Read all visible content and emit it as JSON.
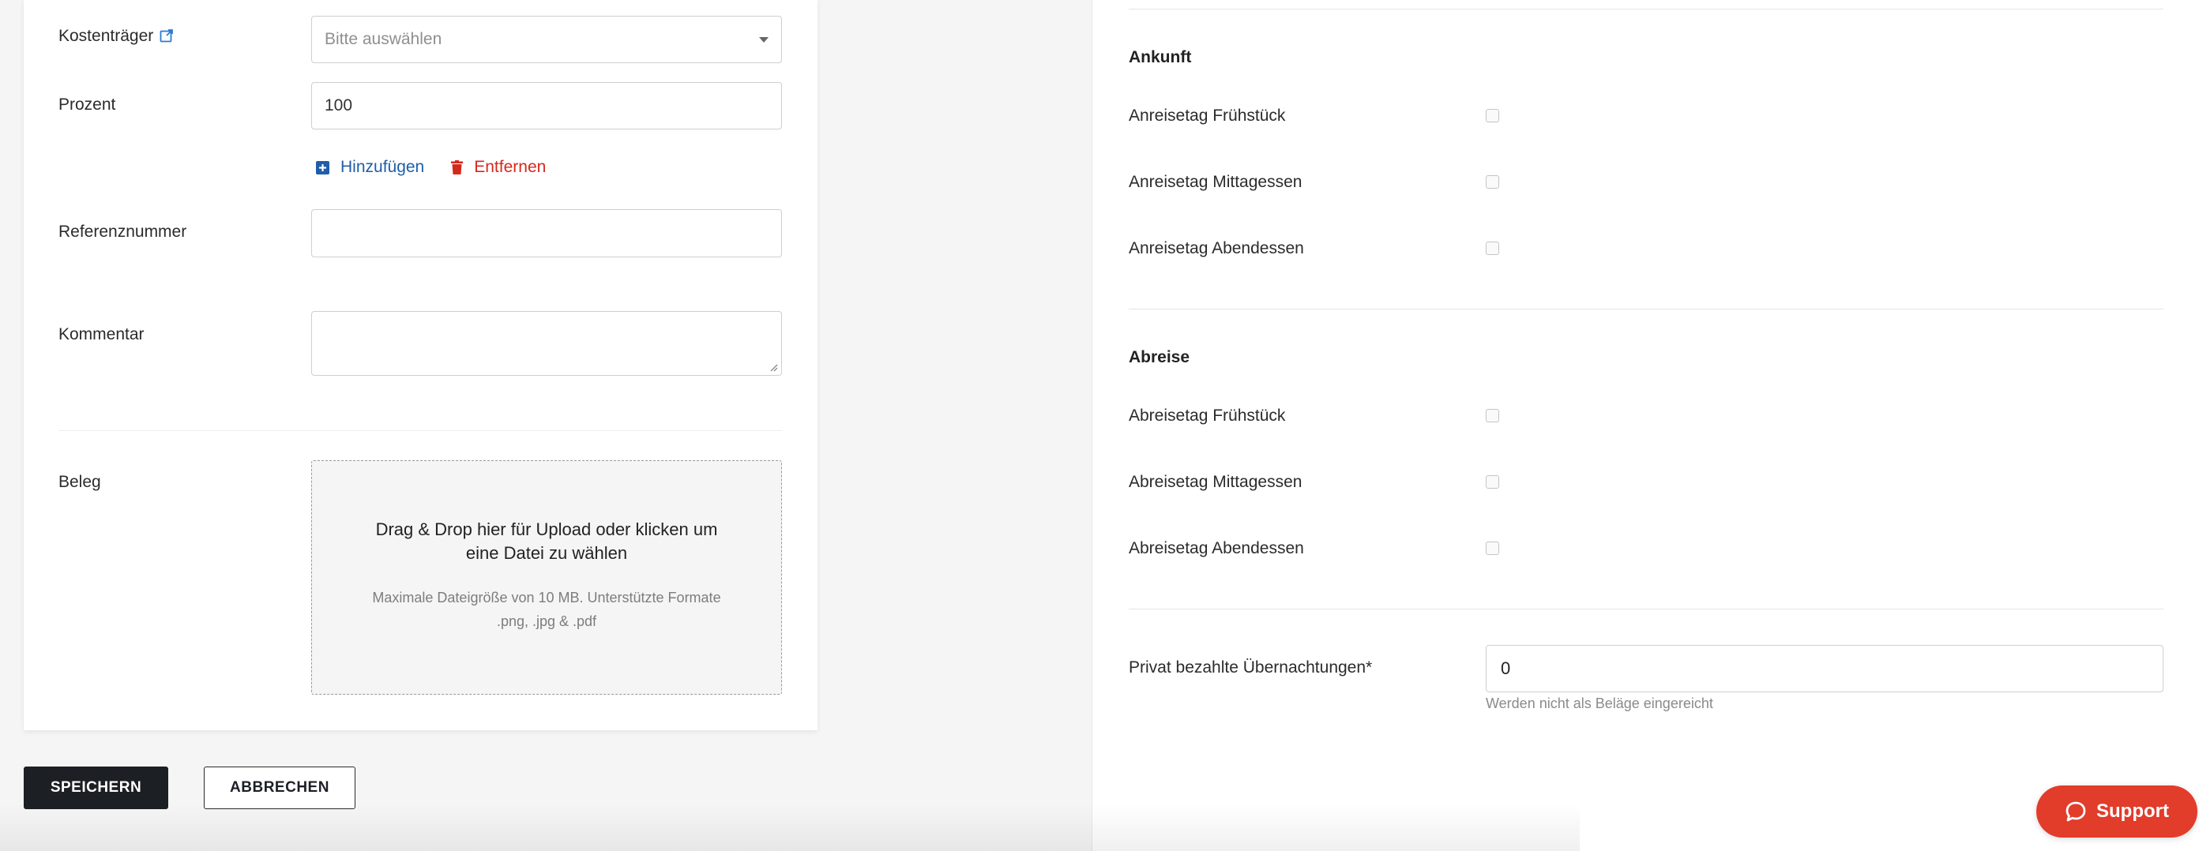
{
  "form": {
    "kostentraeger_label": "Kostenträger",
    "kostentraeger_placeholder": "Bitte auswählen",
    "prozent_label": "Prozent",
    "prozent_value": "100",
    "add_label": "Hinzufügen",
    "remove_label": "Entfernen",
    "referenz_label": "Referenznummer",
    "referenz_value": "",
    "kommentar_label": "Kommentar",
    "kommentar_value": "",
    "beleg_label": "Beleg",
    "dropzone_title": "Drag & Drop hier für Upload oder klicken um eine Datei zu wählen",
    "dropzone_hint": "Maximale Dateigröße von 10 MB. Unterstützte Formate .png, .jpg & .pdf"
  },
  "buttons": {
    "save": "SPEICHERN",
    "cancel": "ABBRECHEN"
  },
  "meals": {
    "arrival_title": "Ankunft",
    "arrival": [
      {
        "label": "Anreisetag Frühstück",
        "checked": false
      },
      {
        "label": "Anreisetag Mittagessen",
        "checked": false
      },
      {
        "label": "Anreisetag Abendessen",
        "checked": false
      }
    ],
    "departure_title": "Abreise",
    "departure": [
      {
        "label": "Abreisetag Frühstück",
        "checked": false
      },
      {
        "label": "Abreisetag Mittagessen",
        "checked": false
      },
      {
        "label": "Abreisetag Abendessen",
        "checked": false
      }
    ]
  },
  "nights": {
    "label": "Privat bezahlte Übernachtungen*",
    "value": "0",
    "hint": "Werden nicht als Beläge eingereicht"
  },
  "support": {
    "label": "Support"
  },
  "colors": {
    "primary_button": "#1c1f24",
    "add_link": "#1f5ea8",
    "remove_link": "#d5291d",
    "support_button": "#e23c2b"
  }
}
